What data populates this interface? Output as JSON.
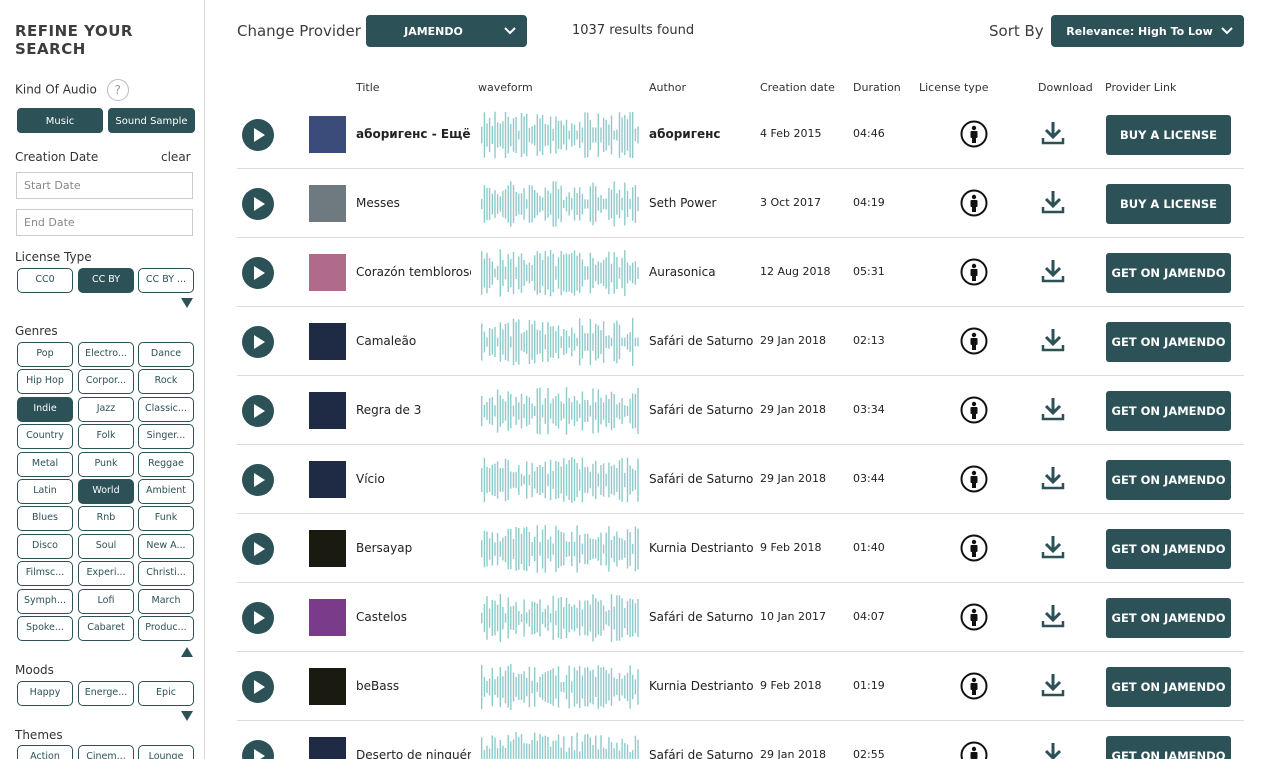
{
  "sidebar": {
    "heading": "REFINE YOUR SEARCH",
    "kind_of_audio": {
      "label": "Kind Of Audio",
      "help": "?",
      "options": [
        "Music",
        "Sound Sample"
      ]
    },
    "creation_date": {
      "label": "Creation Date",
      "clear": "clear",
      "start_placeholder": "Start Date",
      "end_placeholder": "End Date"
    },
    "license_type": {
      "label": "License Type",
      "chips": [
        {
          "label": "CC0",
          "active": false
        },
        {
          "label": "CC BY",
          "active": true
        },
        {
          "label": "CC BY ...",
          "active": false
        }
      ]
    },
    "genres": {
      "label": "Genres",
      "chips": [
        {
          "label": "Pop",
          "active": false
        },
        {
          "label": "Electro...",
          "active": false
        },
        {
          "label": "Dance",
          "active": false
        },
        {
          "label": "Hip Hop",
          "active": false
        },
        {
          "label": "Corpor...",
          "active": false
        },
        {
          "label": "Rock",
          "active": false
        },
        {
          "label": "Indie",
          "active": true
        },
        {
          "label": "Jazz",
          "active": false
        },
        {
          "label": "Classic...",
          "active": false
        },
        {
          "label": "Country",
          "active": false
        },
        {
          "label": "Folk",
          "active": false
        },
        {
          "label": "Singer...",
          "active": false
        },
        {
          "label": "Metal",
          "active": false
        },
        {
          "label": "Punk",
          "active": false
        },
        {
          "label": "Reggae",
          "active": false
        },
        {
          "label": "Latin",
          "active": false
        },
        {
          "label": "World",
          "active": true
        },
        {
          "label": "Ambient",
          "active": false
        },
        {
          "label": "Blues",
          "active": false
        },
        {
          "label": "Rnb",
          "active": false
        },
        {
          "label": "Funk",
          "active": false
        },
        {
          "label": "Disco",
          "active": false
        },
        {
          "label": "Soul",
          "active": false
        },
        {
          "label": "New A...",
          "active": false
        },
        {
          "label": "Filmsc...",
          "active": false
        },
        {
          "label": "Experi...",
          "active": false
        },
        {
          "label": "Christi...",
          "active": false
        },
        {
          "label": "Symph...",
          "active": false
        },
        {
          "label": "Lofi",
          "active": false
        },
        {
          "label": "March",
          "active": false
        },
        {
          "label": "Spoke...",
          "active": false
        },
        {
          "label": "Cabaret",
          "active": false
        },
        {
          "label": "Produc...",
          "active": false
        }
      ]
    },
    "moods": {
      "label": "Moods",
      "chips": [
        {
          "label": "Happy",
          "active": false
        },
        {
          "label": "Energe...",
          "active": false
        },
        {
          "label": "Epic",
          "active": false
        }
      ]
    },
    "themes": {
      "label": "Themes",
      "chips": [
        {
          "label": "Action",
          "active": false
        },
        {
          "label": "Cinem...",
          "active": false
        },
        {
          "label": "Lounge",
          "active": false
        }
      ]
    }
  },
  "topbar": {
    "change_provider_label": "Change Provider",
    "provider_value": "JAMENDO",
    "results": "1037 results found",
    "sort_label": "Sort By",
    "sort_value": "Relevance: High To Low"
  },
  "table": {
    "headers": [
      "Title",
      "waveform",
      "Author",
      "Creation date",
      "Duration",
      "License type",
      "Download",
      "Provider Link"
    ],
    "rows": [
      {
        "title": "аборигенс - Ещё...",
        "author": "аборигенс",
        "date": "4 Feb 2015",
        "duration": "04:46",
        "action": "BUY A LICENSE",
        "thumb_color": "#3b4c7a",
        "bold": true
      },
      {
        "title": "Messes",
        "author": "Seth Power",
        "date": "3 Oct 2017",
        "duration": "04:19",
        "action": "BUY A LICENSE",
        "thumb_color": "#6f7a80",
        "bold": false
      },
      {
        "title": "Corazón tembloroso",
        "author": "Aurasonica",
        "date": "12 Aug 2018",
        "duration": "05:31",
        "action": "GET ON JAMENDO",
        "thumb_color": "#b06a8a",
        "bold": false
      },
      {
        "title": "Camaleão",
        "author": "Safári de Saturno",
        "date": "29 Jan 2018",
        "duration": "02:13",
        "action": "GET ON JAMENDO",
        "thumb_color": "#1f2a44",
        "bold": false
      },
      {
        "title": "Regra de 3",
        "author": "Safári de Saturno",
        "date": "29 Jan 2018",
        "duration": "03:34",
        "action": "GET ON JAMENDO",
        "thumb_color": "#1f2a44",
        "bold": false
      },
      {
        "title": "Vício",
        "author": "Safári de Saturno",
        "date": "29 Jan 2018",
        "duration": "03:44",
        "action": "GET ON JAMENDO",
        "thumb_color": "#1f2a44",
        "bold": false
      },
      {
        "title": "Bersayap",
        "author": "Kurnia Destrianto",
        "date": "9 Feb 2018",
        "duration": "01:40",
        "action": "GET ON JAMENDO",
        "thumb_color": "#1a1a10",
        "bold": false
      },
      {
        "title": "Castelos",
        "author": "Safári de Saturno",
        "date": "10 Jan 2017",
        "duration": "04:07",
        "action": "GET ON JAMENDO",
        "thumb_color": "#7a3c8a",
        "bold": false
      },
      {
        "title": "beBass",
        "author": "Kurnia Destrianto",
        "date": "9 Feb 2018",
        "duration": "01:19",
        "action": "GET ON JAMENDO",
        "thumb_color": "#1a1a10",
        "bold": false
      },
      {
        "title": "Deserto de ninguém",
        "author": "Safári de Saturno",
        "date": "29 Jan 2018",
        "duration": "02:55",
        "action": "GET ON JAMENDO",
        "thumb_color": "#1f2a44",
        "bold": false
      }
    ]
  },
  "colors": {
    "accent": "#2c5157",
    "waveform": "#8fcbcb"
  },
  "icons": {
    "play": "play-icon",
    "license": "person-icon",
    "download": "download-icon",
    "chevron": "chevron-down-icon"
  }
}
